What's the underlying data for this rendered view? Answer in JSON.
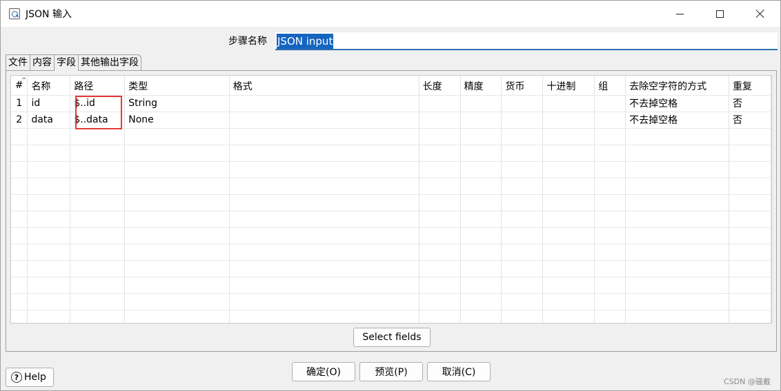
{
  "window": {
    "title": "JSON 输入",
    "minimize_icon": "minimize-icon",
    "maximize_icon": "maximize-icon",
    "close_icon": "close-icon"
  },
  "step": {
    "label": "步骤名称",
    "value": "JSON input"
  },
  "tabs": [
    {
      "label": "文件"
    },
    {
      "label": "内容"
    },
    {
      "label": "字段",
      "active": true
    },
    {
      "label": "其他输出字段"
    }
  ],
  "table": {
    "columns": [
      "#",
      "名称",
      "路径",
      "类型",
      "格式",
      "长度",
      "精度",
      "货币",
      "十进制",
      "组",
      "去除空字符的方式",
      "重复"
    ],
    "rows": [
      [
        "1",
        "id",
        "$..id",
        "String",
        "",
        "",
        "",
        "",
        "",
        "",
        "不去掉空格",
        "否"
      ],
      [
        "2",
        "data",
        "$..data",
        "None",
        "",
        "",
        "",
        "",
        "",
        "",
        "不去掉空格",
        "否"
      ]
    ]
  },
  "buttons": {
    "select_fields": "Select fields",
    "help": "Help",
    "ok": "确定(O)",
    "preview": "预览(P)",
    "cancel": "取消(C)"
  },
  "watermark": "CSDN @骚戴",
  "colors": {
    "selection": "#1565c0",
    "highlight": "#e53935",
    "input_underline": "#2f6fb0"
  }
}
